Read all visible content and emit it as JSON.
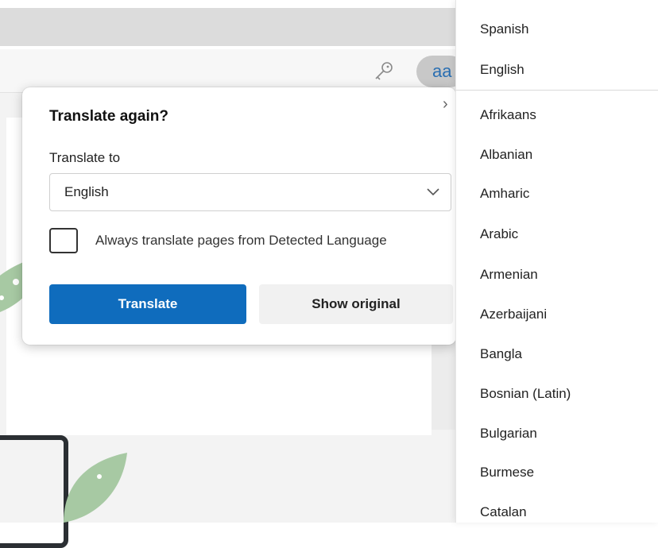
{
  "toolbar": {
    "extension_text": "aa"
  },
  "popup": {
    "title": "Translate again?",
    "translate_to_label": "Translate to",
    "selected_language": "English",
    "always_translate_label": "Always translate pages from Detected Language",
    "always_translate_checked": false,
    "translate_button": "Translate",
    "show_original_button": "Show original"
  },
  "language_list": {
    "recent": [
      "Spanish",
      "English"
    ],
    "all": [
      "Afrikaans",
      "Albanian",
      "Amharic",
      "Arabic",
      "Armenian",
      "Azerbaijani",
      "Bangla",
      "Bosnian (Latin)",
      "Bulgarian",
      "Burmese",
      "Catalan"
    ]
  },
  "colors": {
    "primary_button": "#0f6cbd",
    "secondary_button": "#f1f1f1",
    "leaf_green": "#a7c9a3"
  }
}
